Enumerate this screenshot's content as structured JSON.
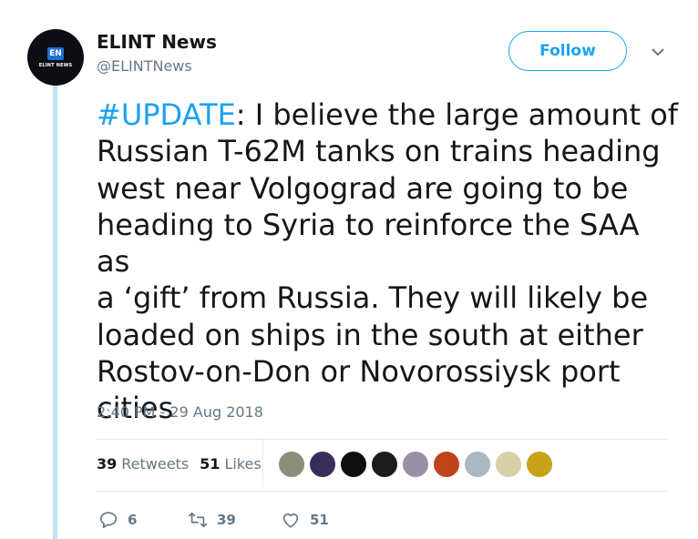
{
  "author": {
    "avatar_badge": "EN",
    "avatar_caption": "ELINT NEWS",
    "display_name": "ELINT News",
    "handle": "@ELINTNews"
  },
  "follow_label": "Follow",
  "tweet": {
    "hashtag": "#UPDATE",
    "body": ": I believe the large amount of\nRussian T-62M tanks on trains heading\nwest near Volgograd are going to be\nheading to Syria to reinforce the SAA as\na ‘gift’ from Russia. They will likely be\nloaded on ships in the south at either\nRostov-on-Don or Novorossiysk port\ncities",
    "timestamp": "2:40 PM - 29 Aug 2018"
  },
  "stats": {
    "retweets_count": "39",
    "retweets_label": "Retweets",
    "likes_count": "51",
    "likes_label": "Likes"
  },
  "likers": [
    {
      "color": "#8a8f7a"
    },
    {
      "color": "#3a2d5a"
    },
    {
      "color": "#101010"
    },
    {
      "color": "#1c1c1c"
    },
    {
      "color": "#9a8fa8"
    },
    {
      "color": "#c0421a"
    },
    {
      "color": "#aab8c2"
    },
    {
      "color": "#d8cfa8"
    },
    {
      "color": "#c8a21a"
    }
  ],
  "actions": {
    "reply_count": "6",
    "retweet_count": "39",
    "like_count": "51"
  },
  "colors": {
    "accent": "#1da1f2",
    "secondary_text": "#657786",
    "quote_bar": "#bfe0f4"
  }
}
